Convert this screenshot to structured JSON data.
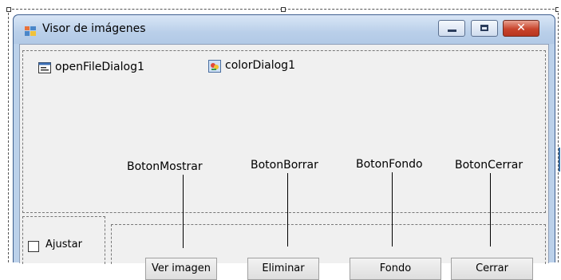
{
  "window": {
    "title": "Visor de imágenes",
    "close_glyph": "✕"
  },
  "components": {
    "open_file_dialog": "openFileDialog1",
    "color_dialog": "colorDialog1"
  },
  "control_names": {
    "mostrar": "BotonMostrar",
    "borrar": "BotonBorrar",
    "fondo": "BotonFondo",
    "cerrar": "BotonCerrar"
  },
  "checkbox": {
    "label": "Ajustar",
    "checked": false
  },
  "buttons": {
    "ver_imagen": "Ver imagen",
    "eliminar": "Eliminar",
    "fondo": "Fondo",
    "cerrar": "Cerrar"
  },
  "colors": {
    "titlebar": "#b9cfe9",
    "client": "#f0f0f0",
    "close_button": "#c8442c"
  }
}
